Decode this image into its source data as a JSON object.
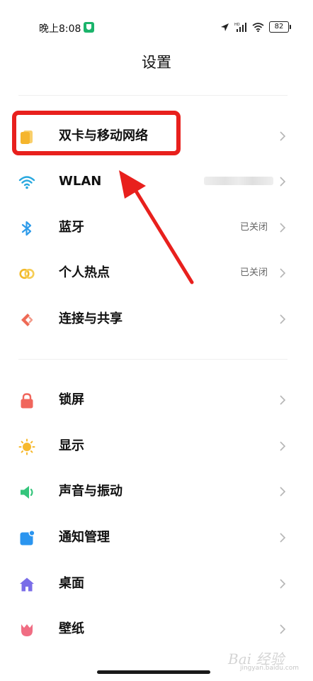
{
  "status_bar": {
    "time": "晚上8:08",
    "battery": "82",
    "signal_badge": "HD"
  },
  "page": {
    "title": "设置"
  },
  "groups": [
    {
      "items": [
        {
          "label": "双卡与移动网络",
          "value": "",
          "icon": "sim-cards-icon",
          "icon_color": "#f5b52c",
          "highlighted": true
        },
        {
          "label": "WLAN",
          "value": "",
          "value_obscured": true,
          "icon": "wifi-icon",
          "icon_color": "#28a8df"
        },
        {
          "label": "蓝牙",
          "value": "已关闭",
          "icon": "bluetooth-icon",
          "icon_color": "#2e9bea"
        },
        {
          "label": "个人热点",
          "value": "已关闭",
          "icon": "hotspot-icon",
          "icon_color": "#f2b92a"
        },
        {
          "label": "连接与共享",
          "value": "",
          "icon": "connection-share-icon",
          "icon_color": "#ee6a55"
        }
      ]
    },
    {
      "items": [
        {
          "label": "锁屏",
          "value": "",
          "icon": "lock-icon",
          "icon_color": "#f0665c"
        },
        {
          "label": "显示",
          "value": "",
          "icon": "sun-icon",
          "icon_color": "#f7b92d"
        },
        {
          "label": "声音与振动",
          "value": "",
          "icon": "speaker-icon",
          "icon_color": "#35c57c"
        },
        {
          "label": "通知管理",
          "value": "",
          "icon": "notification-icon",
          "icon_color": "#2b95ef"
        },
        {
          "label": "桌面",
          "value": "",
          "icon": "home-icon",
          "icon_color": "#7a6de8"
        },
        {
          "label": "壁纸",
          "value": "",
          "icon": "tulip-icon",
          "icon_color": "#f06d83"
        }
      ]
    }
  ],
  "annotation": {
    "color": "#e8201d"
  },
  "watermark": {
    "text": "Bai 经验",
    "subtext": "jingyan.baidu.com"
  }
}
